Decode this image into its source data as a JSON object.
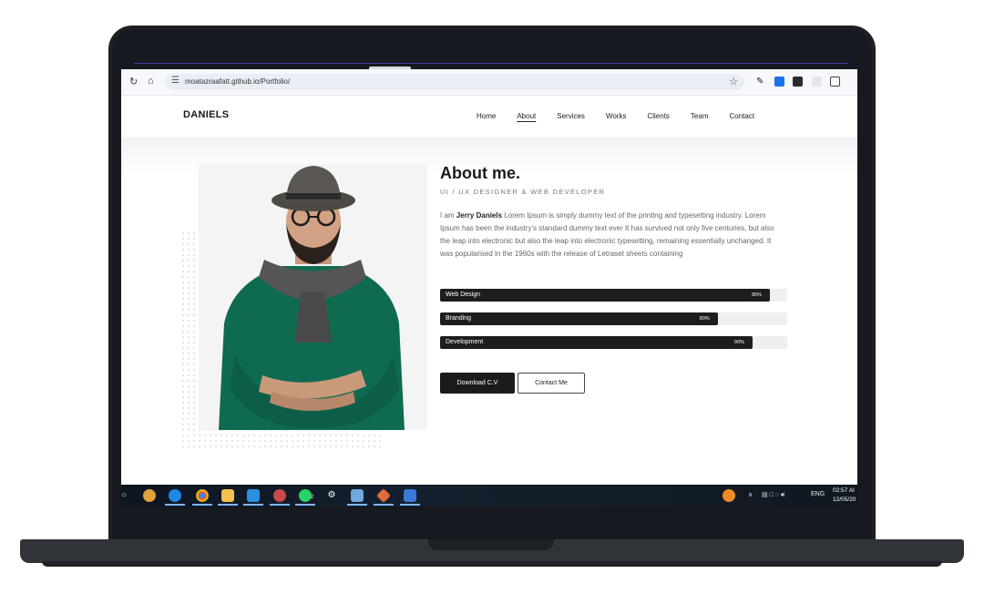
{
  "browser": {
    "url": "moatazraafatt.github.io/Portfolio/",
    "reload_icon": "reload-icon",
    "home_icon": "home-icon",
    "bookmark_icon": "star-icon"
  },
  "site": {
    "logo": "DANIELS",
    "menu": [
      {
        "label": "Home",
        "active": false
      },
      {
        "label": "About",
        "active": true
      },
      {
        "label": "Services",
        "active": false
      },
      {
        "label": "Works",
        "active": false
      },
      {
        "label": "Clients",
        "active": false
      },
      {
        "label": "Team",
        "active": false
      },
      {
        "label": "Contact",
        "active": false
      }
    ]
  },
  "about": {
    "title": "About me.",
    "subtitle": "UI / UX DESIGNER & WEB DEVELOPER",
    "intro": "I am",
    "name": "Jerry Daniels",
    "body": "Lorem Ipsum is simply dummy text of the printing and typesetting industry. Lorem Ipsum has been the industry's standard dummy text ever It has survived not only five centuries, but also the leap into electronic but also the leap into electronic typesetting, remaining essentially unchanged. It was popularised in the 1960s with the release of Letraset sheets containing",
    "skills": [
      {
        "label": "Web Design",
        "percent": 95,
        "pct_label": "95%"
      },
      {
        "label": "Branding",
        "percent": 80,
        "pct_label": "80%"
      },
      {
        "label": "Development",
        "percent": 90,
        "pct_label": "90%"
      }
    ],
    "download_label": "Download C.V",
    "contact_label": "Contact Me"
  },
  "taskbar": {
    "tray_lang": "ENG",
    "time": "02:57 AI",
    "date": "12/05/20",
    "whatsapp_badge": "2"
  },
  "colors": {
    "accent_dark": "#1d1d1d",
    "sweater": "#0f6a52",
    "laptop_body": "#1c1f24"
  }
}
